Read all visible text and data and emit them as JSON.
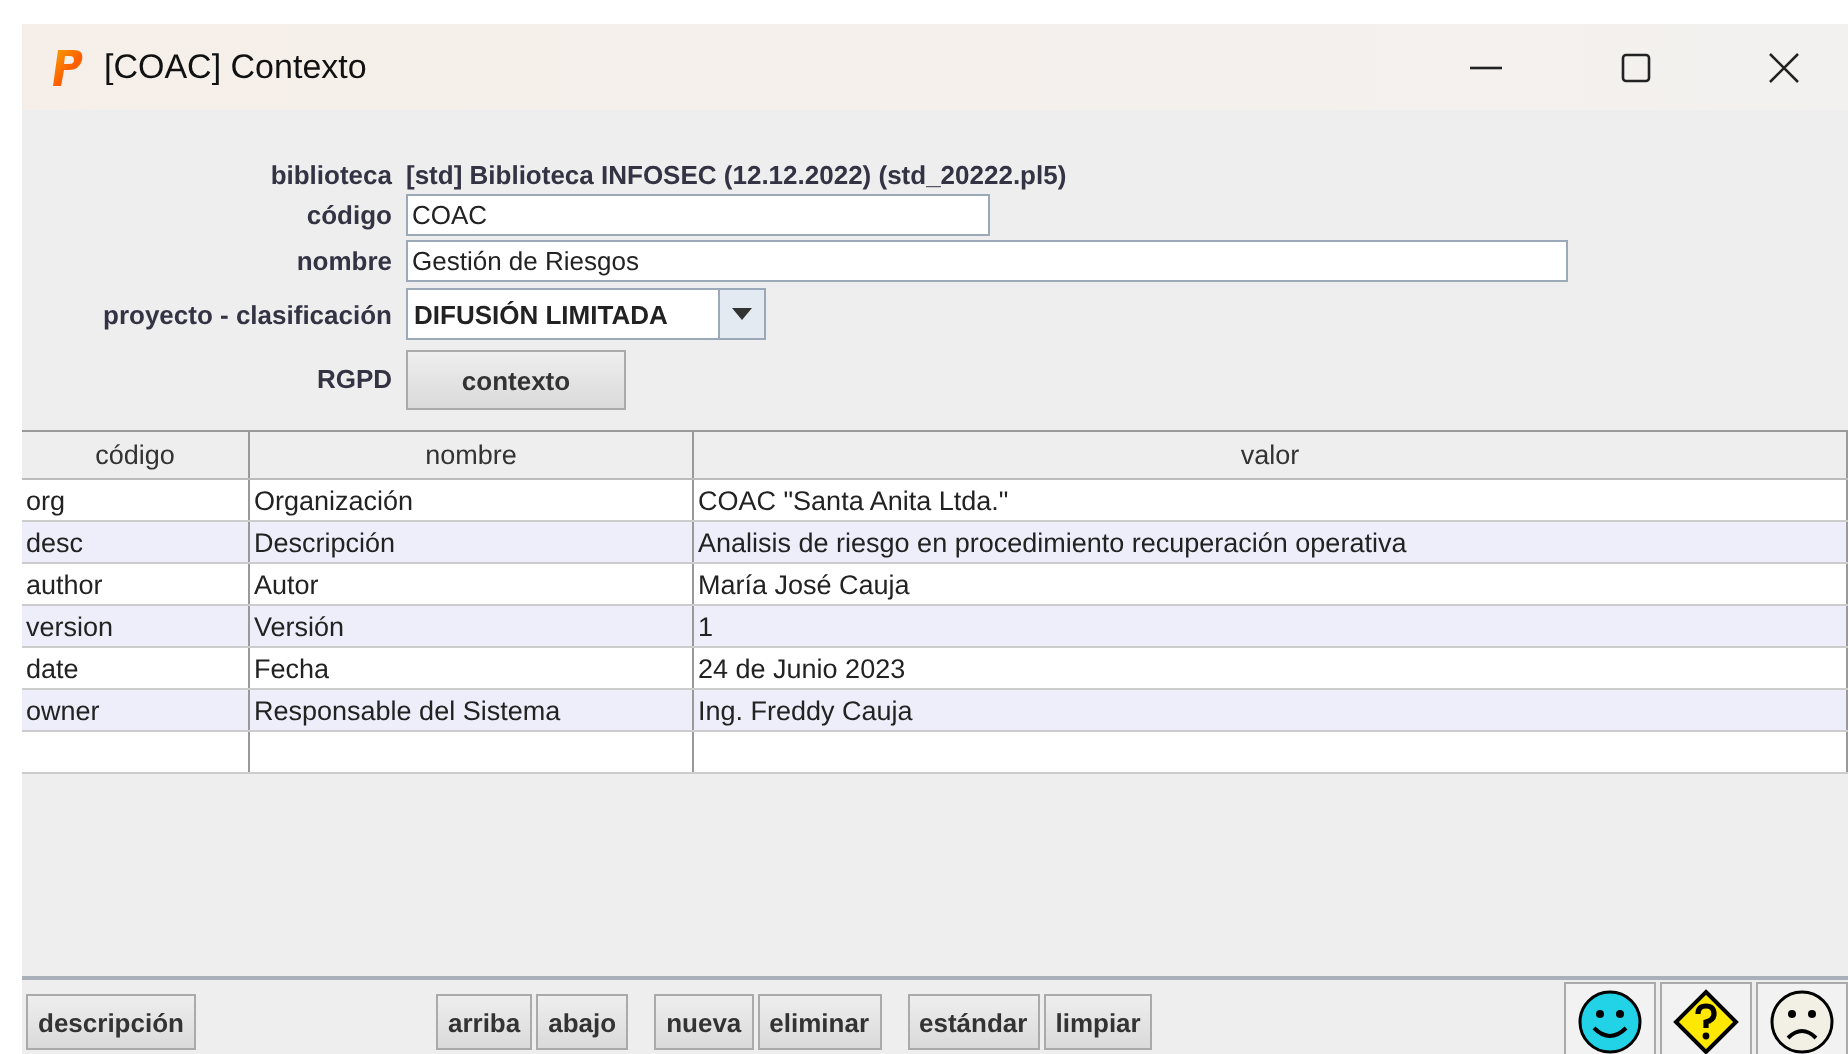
{
  "window": {
    "title": "[COAC] Contexto"
  },
  "form": {
    "biblioteca_label": "biblioteca",
    "biblioteca_value": "[std] Biblioteca INFOSEC (12.12.2022) (std_20222.pl5)",
    "codigo_label": "código",
    "codigo_value": "COAC",
    "nombre_label": "nombre",
    "nombre_value": "Gestión de Riesgos",
    "clasificacion_label": "proyecto - clasificación",
    "clasificacion_value": "DIFUSIÓN LIMITADA",
    "rgpd_label": "RGPD",
    "rgpd_button": "contexto"
  },
  "table": {
    "columns": [
      "código",
      "nombre",
      "valor"
    ],
    "rows": [
      {
        "cells": [
          "org",
          "Organización",
          "COAC \"Santa Anita Ltda.\""
        ]
      },
      {
        "cells": [
          "desc",
          "Descripción",
          "Analisis de riesgo en procedimiento recuperación operativa"
        ]
      },
      {
        "cells": [
          "author",
          "Autor",
          "María José Cauja"
        ]
      },
      {
        "cells": [
          "version",
          "Versión",
          "1"
        ]
      },
      {
        "cells": [
          "date",
          "Fecha",
          "24 de Junio 2023"
        ]
      },
      {
        "cells": [
          "owner",
          "Responsable del Sistema",
          "Ing. Freddy Cauja"
        ]
      },
      {
        "cells": [
          "",
          "",
          ""
        ]
      }
    ]
  },
  "button_groups": [
    [
      "descripción"
    ],
    [
      "arriba",
      "abajo"
    ],
    [
      "nueva",
      "eliminar"
    ],
    [
      "estándar",
      "limpiar"
    ]
  ]
}
